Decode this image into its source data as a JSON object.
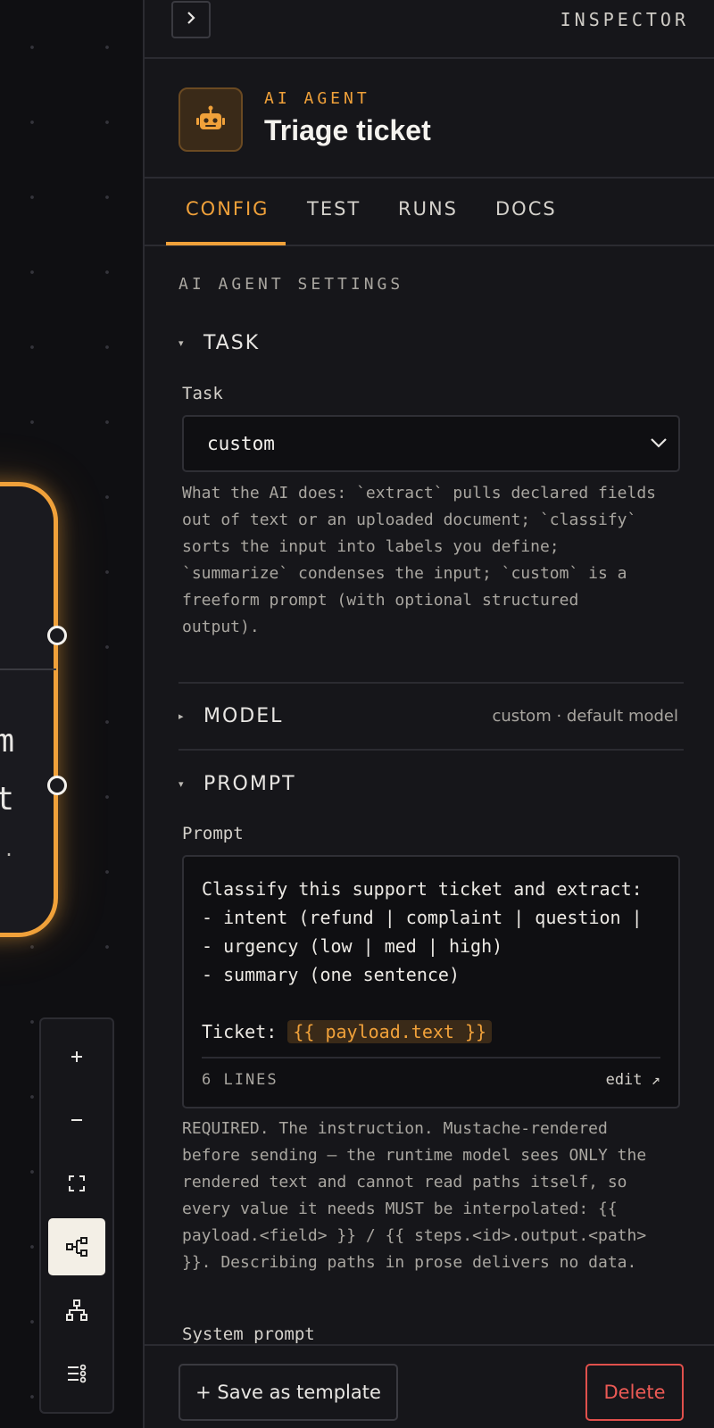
{
  "canvas": {
    "node": {
      "partial_line_1": "m",
      "partial_line_2": "t",
      "partial_line_3": "."
    },
    "controls": {
      "zoom_in": "+",
      "zoom_out": "−",
      "icons": [
        "plus-icon",
        "minus-icon",
        "fit-view-icon",
        "flow-layout-icon",
        "tree-layout-icon",
        "list-settings-icon"
      ],
      "active": "flow-layout-icon"
    }
  },
  "inspector": {
    "title": "INSPECTOR",
    "collapse_icon": "chevron-right-icon",
    "node": {
      "kind": "AI AGENT",
      "name": "Triage ticket",
      "icon": "robot-icon"
    },
    "tabs": [
      {
        "label": "CONFIG",
        "active": true
      },
      {
        "label": "TEST",
        "active": false
      },
      {
        "label": "RUNS",
        "active": false
      },
      {
        "label": "DOCS",
        "active": false
      }
    ],
    "section_title": "AI AGENT SETTINGS",
    "task_group": {
      "title": "TASK",
      "expanded": true,
      "field_label": "Task",
      "value": "custom",
      "help": "What the AI does: `extract` pulls declared fields out of text or an uploaded document; `classify` sorts the input into labels you define; `summarize` condenses the input; `custom` is a freeform prompt (with optional structured output)."
    },
    "model_group": {
      "title": "MODEL",
      "expanded": false,
      "summary": "custom · default model"
    },
    "prompt_group": {
      "title": "PROMPT",
      "expanded": true,
      "field_label": "Prompt",
      "lines": [
        "Classify this support ticket and extract:",
        "- intent (refund | complaint | question |",
        "- urgency (low | med | high)",
        "- summary (one sentence)",
        "",
        "Ticket: "
      ],
      "variable": "{{ payload.text }}",
      "line_count": "6 LINES",
      "edit_label": "edit ↗",
      "help": "REQUIRED. The instruction. Mustache-rendered before sending — the runtime model sees ONLY the rendered text and cannot read paths itself, so every value it needs MUST be interpolated: {{ payload.<field> }} / {{ steps.<id>.output.<path> }}. Describing paths in prose delivers no data.",
      "system_prompt_label": "System prompt"
    },
    "footer": {
      "save_template": "+ Save as template",
      "delete": "Delete"
    }
  },
  "colors": {
    "accent": "#f0a13a",
    "danger": "#ec5a55",
    "panel_bg": "#16161a",
    "canvas_bg": "#0f0f12"
  }
}
